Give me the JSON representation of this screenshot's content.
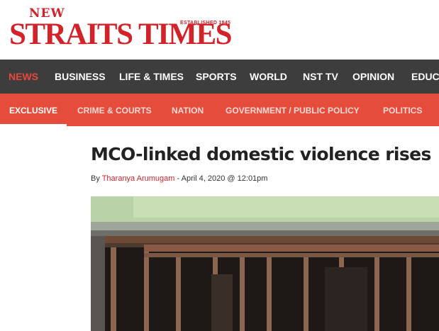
{
  "masthead": {
    "logo_top": "NEW",
    "logo_main": "STRAITS TIMES",
    "established": "ESTABLISHED 1845",
    "brand_color": "#d2232a"
  },
  "primary_nav": {
    "background": "#3d3d3d",
    "active_color": "#e9473b",
    "items": [
      {
        "label": "NEWS",
        "active": true
      },
      {
        "label": "BUSINESS",
        "active": false
      },
      {
        "label": "LIFE & TIMES",
        "active": false
      },
      {
        "label": "SPORTS",
        "active": false
      },
      {
        "label": "WORLD",
        "active": false
      },
      {
        "label": "NST TV",
        "active": false
      },
      {
        "label": "OPINION",
        "active": false
      },
      {
        "label": "EDUC",
        "active": false
      }
    ]
  },
  "secondary_nav": {
    "background": "#e64c3c",
    "items": [
      {
        "label": "EXCLUSIVE",
        "active": true
      },
      {
        "label": "CRIME & COURTS",
        "active": false
      },
      {
        "label": "NATION",
        "active": false
      },
      {
        "label": "GOVERNMENT / PUBLIC POLICY",
        "active": false
      },
      {
        "label": "POLITICS",
        "active": false
      }
    ]
  },
  "article": {
    "headline": "MCO-linked domestic violence rises",
    "byline_prefix": "By",
    "author": "Tharanya Arumugam",
    "date_separator": "-",
    "date": "April 4, 2020 @ 12:01pm",
    "photo_icon": "window-grille-photo"
  }
}
